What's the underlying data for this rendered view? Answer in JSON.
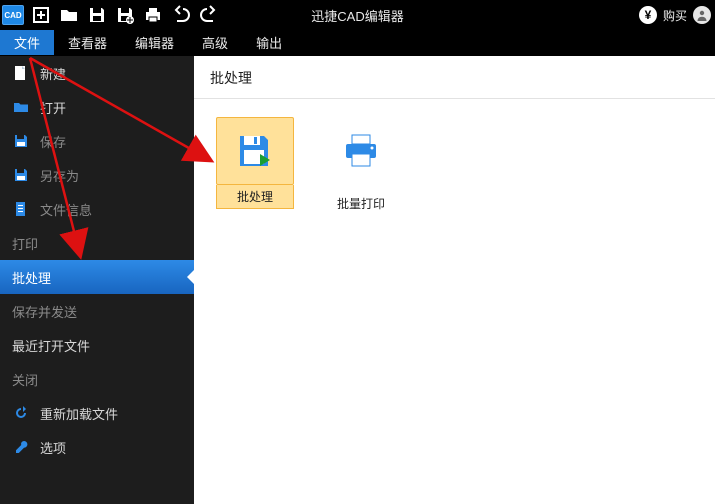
{
  "app": {
    "logo_text": "CAD",
    "title": "迅捷CAD编辑器",
    "buy_label": "购买"
  },
  "tabs": {
    "file": "文件",
    "viewer": "查看器",
    "editor": "编辑器",
    "advanced": "高级",
    "output": "输出"
  },
  "sidebar": {
    "new": "新建",
    "open": "打开",
    "save": "保存",
    "save_as": "另存为",
    "file_info": "文件信息",
    "print": "打印",
    "batch": "批处理",
    "save_send": "保存并发送",
    "recent": "最近打开文件",
    "close": "关闭",
    "reload": "重新加载文件",
    "options": "选项"
  },
  "content": {
    "header": "批处理",
    "batch_btn": "批处理",
    "batch_print_btn": "批量打印"
  }
}
